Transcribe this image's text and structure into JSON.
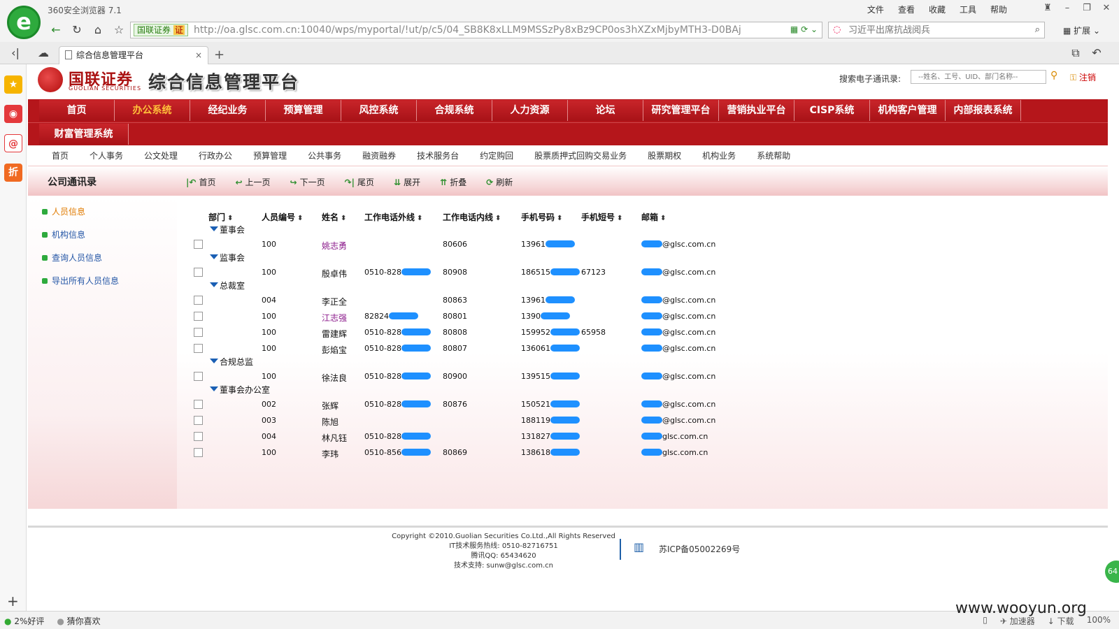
{
  "browser": {
    "title": "360安全浏览器 7.1",
    "logo": "e",
    "menu": [
      "文件",
      "查看",
      "收藏",
      "工具",
      "帮助"
    ],
    "url": "http://oa.glsc.com.cn:10040/wps/myportal/!ut/p/c5/04_SB8K8xLLM9MSSzPy8xBz9CP0os3hXZxMjbyMTH3-D0BAj",
    "site_badge": "国联证券",
    "cert_label": "证",
    "search_placeholder": "习近平出席抗战阅兵",
    "extensions_label": "扩展",
    "tab_title": "综合信息管理平台",
    "tab_close": "×",
    "tab_new": "+"
  },
  "header": {
    "logo_cn": "国联证券",
    "logo_en": "GUOLIAN SECURITIES",
    "platform_title": "综合信息管理平台",
    "directory_label": "搜索电子通讯录:",
    "directory_placeholder": "--姓名、工号、UID、部门名称--",
    "logout": "注销"
  },
  "main_nav": {
    "row1": [
      "首页",
      "办公系统",
      "经纪业务",
      "预算管理",
      "风控系统",
      "合规系统",
      "人力资源",
      "论坛",
      "研究管理平台",
      "营销执业平台",
      "CISP系统",
      "机构客户管理",
      "内部报表系统"
    ],
    "row2": [
      "财富管理系统"
    ],
    "active": "办公系统"
  },
  "sub_nav": [
    "首页",
    "个人事务",
    "公文处理",
    "行政办公",
    "预算管理",
    "公共事务",
    "融资融券",
    "技术服务台",
    "约定购回",
    "股票质押式回购交易业务",
    "股票期权",
    "机构业务",
    "系统帮助"
  ],
  "content": {
    "title": "公司通讯录",
    "pager": [
      "首页",
      "上一页",
      "下一页",
      "尾页",
      "展开",
      "折叠",
      "刷新"
    ]
  },
  "left_menu": [
    {
      "label": "人员信息",
      "active": true
    },
    {
      "label": "机构信息",
      "active": false
    },
    {
      "label": "查询人员信息",
      "active": false
    },
    {
      "label": "导出所有人员信息",
      "active": false
    }
  ],
  "table": {
    "columns": [
      "部门",
      "人员编号",
      "姓名",
      "工作电话外线",
      "工作电话内线",
      "手机号码",
      "手机短号",
      "邮箱"
    ],
    "sort_icon": "⬍",
    "groups": [
      {
        "dept": "董事会",
        "rows": [
          {
            "id": "100",
            "name": "姚志勇",
            "link": true,
            "ext_phone": "",
            "int_phone": "80606",
            "mobile": "13961",
            "short": "",
            "email": "@glsc.com.cn"
          }
        ]
      },
      {
        "dept": "监事会",
        "rows": [
          {
            "id": "100",
            "name": "殷卓伟",
            "link": false,
            "ext_phone": "0510-828",
            "int_phone": "80908",
            "mobile": "186515",
            "short": "67123",
            "email": "@glsc.com.cn"
          }
        ]
      },
      {
        "dept": "总裁室",
        "rows": [
          {
            "id": "004",
            "name": "李正全",
            "link": false,
            "ext_phone": "",
            "int_phone": "80863",
            "mobile": "13961",
            "short": "",
            "email": "@glsc.com.cn"
          },
          {
            "id": "100",
            "name": "江志强",
            "link": true,
            "ext_phone": "82824",
            "int_phone": "80801",
            "mobile": "1390",
            "short": "",
            "email": "@glsc.com.cn"
          },
          {
            "id": "100",
            "name": "雷建辉",
            "link": false,
            "ext_phone": "0510-828",
            "int_phone": "80808",
            "mobile": "159952",
            "short": "65958",
            "email": "@glsc.com.cn"
          },
          {
            "id": "100",
            "name": "彭焰宝",
            "link": false,
            "ext_phone": "0510-828",
            "int_phone": "80807",
            "mobile": "136061",
            "short": "",
            "email": "@glsc.com.cn"
          }
        ]
      },
      {
        "dept": "合规总监",
        "rows": [
          {
            "id": "100",
            "name": "徐法良",
            "link": false,
            "ext_phone": "0510-828",
            "int_phone": "80900",
            "mobile": "139515",
            "short": "",
            "email": "@glsc.com.cn"
          }
        ]
      },
      {
        "dept": "董事会办公室",
        "rows": [
          {
            "id": "002",
            "name": "张辉",
            "link": false,
            "ext_phone": "0510-828",
            "int_phone": "80876",
            "mobile": "150521",
            "short": "",
            "email": "@glsc.com.cn"
          },
          {
            "id": "003",
            "name": "陈旭",
            "link": false,
            "ext_phone": "",
            "int_phone": "",
            "mobile": "188119",
            "short": "",
            "email": "@glsc.com.cn"
          },
          {
            "id": "004",
            "name": "林凡钰",
            "link": false,
            "ext_phone": "0510-828",
            "int_phone": "",
            "mobile": "131827",
            "short": "",
            "email": "glsc.com.cn"
          },
          {
            "id": "100",
            "name": "李玮",
            "link": false,
            "ext_phone": "0510-856",
            "int_phone": "80869",
            "mobile": "138618",
            "short": "",
            "email": "glsc.com.cn"
          }
        ]
      }
    ]
  },
  "footer": {
    "copyright": "Copyright ©2010.Guolian Securities Co.Ltd.,All Rights Reserved",
    "hotline": "IT技术服务热线: 0510-82716751",
    "qq": "腾讯QQ: 65434620",
    "support": "技术支持: sunw@glsc.com.cn",
    "icp": "苏ICP备05002269号"
  },
  "status": {
    "left": [
      "2%好评",
      "猜你喜欢"
    ],
    "right": [
      "加速器",
      "下载",
      "100%"
    ],
    "watermark": "www.wooyun.org",
    "badge": "64"
  },
  "colors": {
    "brand_red": "#b5161b",
    "link_blue": "#2456a6",
    "active_orange": "#e07a00",
    "mask_blue": "#1e90ff"
  }
}
